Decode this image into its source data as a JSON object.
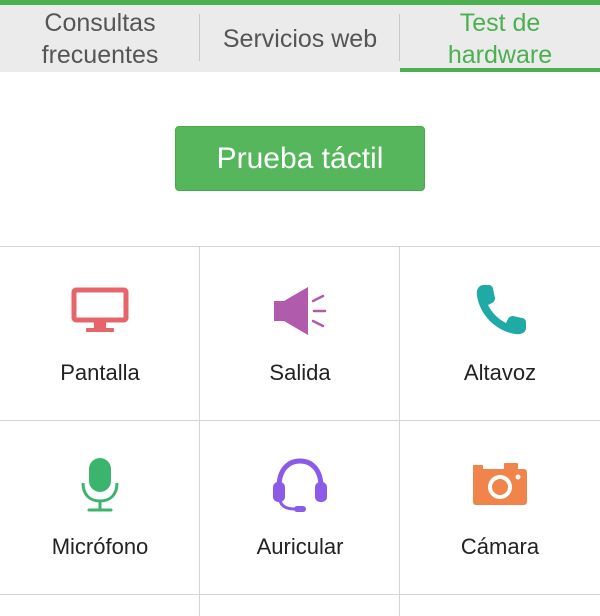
{
  "tabs": [
    {
      "label": "Consultas\nfrecuentes",
      "active": false
    },
    {
      "label": "Servicios web",
      "active": false
    },
    {
      "label": "Test de\nhardware",
      "active": true
    }
  ],
  "touch_test_button": "Prueba táctil",
  "grid": [
    {
      "label": "Pantalla",
      "icon": "monitor-icon",
      "color": "#e8646b"
    },
    {
      "label": "Salida",
      "icon": "speaker-icon",
      "color": "#b05bab"
    },
    {
      "label": "Altavoz",
      "icon": "phone-icon",
      "color": "#1faaa5"
    },
    {
      "label": "Micrófono",
      "icon": "microphone-icon",
      "color": "#3bb56d"
    },
    {
      "label": "Auricular",
      "icon": "headset-icon",
      "color": "#8b5be8"
    },
    {
      "label": "Cámara",
      "icon": "camera-icon",
      "color": "#f0844a"
    }
  ],
  "colors": {
    "accent": "#4caf50",
    "tab_bg": "#ebebeb"
  }
}
